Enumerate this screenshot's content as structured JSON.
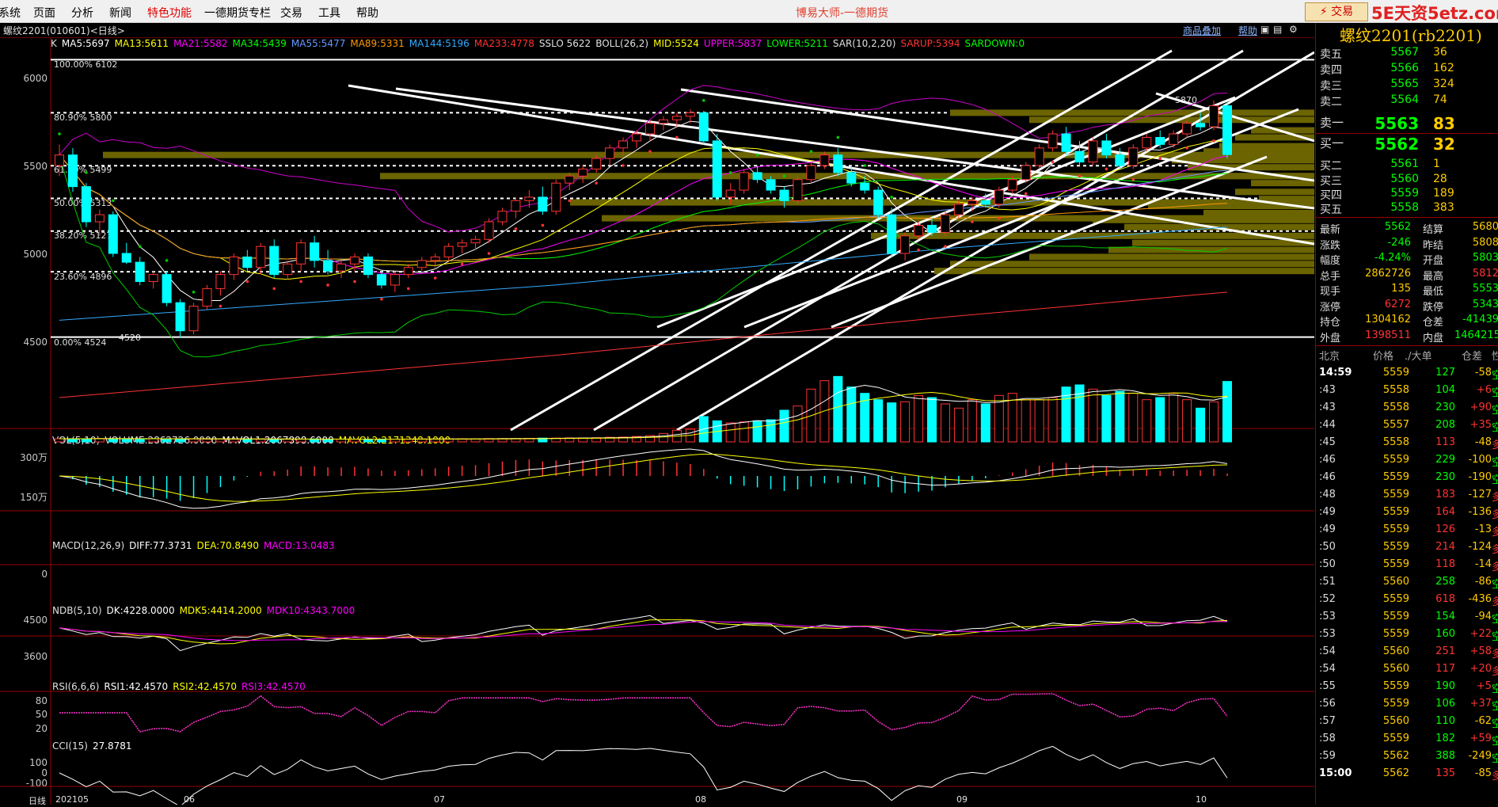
{
  "menu": {
    "items": [
      "系统",
      "页面",
      "分析",
      "新闻",
      "特色功能",
      "一德期货专栏",
      "交易",
      "工具",
      "帮助"
    ],
    "title": "博易大师-一德期货",
    "trade_button": "交易",
    "watermark": "5E天资5etz.com"
  },
  "chart_header": {
    "symbol": "螺纹2201(010601)<日线>",
    "btn_overlay": "商品叠加",
    "btn_help": "帮助"
  },
  "indicators": {
    "main": [
      {
        "text": "K",
        "color": "#e0e0e0"
      },
      {
        "text": "MA5:5697",
        "color": "#ffffff"
      },
      {
        "text": "MA13:5611",
        "color": "#ffff00"
      },
      {
        "text": "MA21:5582",
        "color": "#ff00ff"
      },
      {
        "text": "MA34:5439",
        "color": "#00ff00"
      },
      {
        "text": "MA55:5477",
        "color": "#6699ff"
      },
      {
        "text": "MA89:5331",
        "color": "#ff9900"
      },
      {
        "text": "MA144:5196",
        "color": "#33aaff"
      },
      {
        "text": "MA233:4778",
        "color": "#ff3333"
      },
      {
        "text": "SSLO 5622",
        "color": "#e0e0e0"
      },
      {
        "text": "BOLL(26,2)",
        "color": "#e0e0e0"
      },
      {
        "text": "MID:5524",
        "color": "#ffff00"
      },
      {
        "text": "UPPER:5837",
        "color": "#ff00ff"
      },
      {
        "text": "LOWER:5211",
        "color": "#00ff00"
      },
      {
        "text": "SAR(10,2,20)",
        "color": "#e0e0e0"
      },
      {
        "text": "SARUP:5394",
        "color": "#ff3333"
      },
      {
        "text": "SARDOWN:0",
        "color": "#00ff00"
      }
    ],
    "vol": [
      {
        "text": "VOL(5,10)",
        "color": "#e0e0e0"
      },
      {
        "text": "VOLUME:2862726.0000",
        "color": "#e0e0e0"
      },
      {
        "text": "MAVOL1:2067898.6000",
        "color": "#ffffff"
      },
      {
        "text": "MAVOL2:2171348.1000",
        "color": "#ffff00"
      }
    ],
    "macd": [
      {
        "text": "MACD(12,26,9)",
        "color": "#e0e0e0"
      },
      {
        "text": "DIFF:77.3731",
        "color": "#ffffff"
      },
      {
        "text": "DEA:70.8490",
        "color": "#ffff00"
      },
      {
        "text": "MACD:13.0483",
        "color": "#ff00ff"
      }
    ],
    "ndb": [
      {
        "text": "NDB(5,10)",
        "color": "#e0e0e0"
      },
      {
        "text": "DK:4228.0000",
        "color": "#ffffff"
      },
      {
        "text": "MDK5:4414.2000",
        "color": "#ffff00"
      },
      {
        "text": "MDK10:4343.7000",
        "color": "#ff00ff"
      }
    ],
    "rsi": [
      {
        "text": "RSI(6,6,6)",
        "color": "#e0e0e0"
      },
      {
        "text": "RSI1:42.4570",
        "color": "#ffffff"
      },
      {
        "text": "RSI2:42.4570",
        "color": "#ffff00"
      },
      {
        "text": "RSI3:42.4570",
        "color": "#ff00ff"
      }
    ],
    "cci": [
      {
        "text": "CCI(15)",
        "color": "#e0e0e0"
      },
      {
        "text": "27.8781",
        "color": "#ffffff"
      }
    ]
  },
  "axes": {
    "price": [
      "6000",
      "5500",
      "5000",
      "4500"
    ],
    "vol": [
      "300万",
      "150万"
    ],
    "macd": [
      "0"
    ],
    "ndb": [
      "4500",
      "3600"
    ],
    "rsi": [
      "80",
      "50",
      "20"
    ],
    "cci": [
      "100",
      "0",
      "-100"
    ],
    "xaxis_label": "日线",
    "dates": [
      "202105",
      "06",
      "07",
      "08",
      "09",
      "10"
    ]
  },
  "fib": [
    {
      "label": "100.00% 6102"
    },
    {
      "label": "80.90% 5800"
    },
    {
      "label": "61.80% 5499"
    },
    {
      "label": "50.00% 5313"
    },
    {
      "label": "38.20% 5127"
    },
    {
      "label": "23.60% 4896"
    },
    {
      "label": "0.00% 4524"
    }
  ],
  "annotations": {
    "high": "5870",
    "low": "4520"
  },
  "chart_data": {
    "type": "table",
    "candles_ohlc": [
      [
        5500,
        5620,
        5440,
        5560
      ],
      [
        5560,
        5600,
        5350,
        5380
      ],
      [
        5380,
        5400,
        5150,
        5180
      ],
      [
        5180,
        5250,
        5100,
        5220
      ],
      [
        5220,
        5240,
        4980,
        5000
      ],
      [
        5000,
        5060,
        4940,
        4950
      ],
      [
        4950,
        4980,
        4820,
        4840
      ],
      [
        4840,
        4900,
        4800,
        4880
      ],
      [
        4880,
        4900,
        4700,
        4720
      ],
      [
        4720,
        4740,
        4520,
        4560
      ],
      [
        4560,
        4720,
        4540,
        4700
      ],
      [
        4700,
        4820,
        4680,
        4800
      ],
      [
        4800,
        4900,
        4760,
        4880
      ],
      [
        4880,
        5000,
        4850,
        4980
      ],
      [
        4980,
        5020,
        4900,
        4920
      ],
      [
        4920,
        5060,
        4880,
        5040
      ],
      [
        5040,
        5080,
        4860,
        4880
      ],
      [
        4880,
        4960,
        4850,
        4940
      ],
      [
        4940,
        5080,
        4900,
        5060
      ],
      [
        5060,
        5100,
        4920,
        4960
      ],
      [
        4960,
        5020,
        4880,
        4900
      ],
      [
        4900,
        4960,
        4860,
        4940
      ],
      [
        4940,
        5000,
        4900,
        4980
      ],
      [
        4980,
        5000,
        4860,
        4880
      ],
      [
        4880,
        4900,
        4800,
        4820
      ],
      [
        4820,
        4900,
        4780,
        4880
      ],
      [
        4880,
        4940,
        4860,
        4920
      ],
      [
        4920,
        4980,
        4900,
        4960
      ],
      [
        4960,
        5000,
        4920,
        4980
      ],
      [
        4980,
        5060,
        4960,
        5040
      ],
      [
        5040,
        5080,
        5000,
        5060
      ],
      [
        5060,
        5100,
        5020,
        5080
      ],
      [
        5080,
        5200,
        5060,
        5180
      ],
      [
        5180,
        5260,
        5160,
        5240
      ],
      [
        5240,
        5320,
        5200,
        5300
      ],
      [
        5300,
        5360,
        5260,
        5320
      ],
      [
        5320,
        5380,
        5220,
        5240
      ],
      [
        5240,
        5420,
        5220,
        5400
      ],
      [
        5400,
        5460,
        5360,
        5440
      ],
      [
        5440,
        5500,
        5400,
        5480
      ],
      [
        5480,
        5560,
        5460,
        5540
      ],
      [
        5540,
        5620,
        5500,
        5600
      ],
      [
        5600,
        5660,
        5560,
        5640
      ],
      [
        5640,
        5700,
        5600,
        5680
      ],
      [
        5680,
        5760,
        5640,
        5740
      ],
      [
        5740,
        5780,
        5700,
        5760
      ],
      [
        5760,
        5800,
        5720,
        5780
      ],
      [
        5780,
        5820,
        5740,
        5800
      ],
      [
        5800,
        5810,
        5620,
        5640
      ],
      [
        5640,
        5680,
        5300,
        5320
      ],
      [
        5320,
        5400,
        5280,
        5360
      ],
      [
        5360,
        5480,
        5340,
        5460
      ],
      [
        5460,
        5500,
        5400,
        5420
      ],
      [
        5420,
        5440,
        5340,
        5360
      ],
      [
        5360,
        5380,
        5260,
        5300
      ],
      [
        5300,
        5440,
        5280,
        5420
      ],
      [
        5420,
        5520,
        5400,
        5500
      ],
      [
        5500,
        5580,
        5480,
        5560
      ],
      [
        5560,
        5600,
        5440,
        5460
      ],
      [
        5460,
        5500,
        5380,
        5400
      ],
      [
        5400,
        5440,
        5340,
        5360
      ],
      [
        5360,
        5380,
        5200,
        5220
      ],
      [
        5220,
        5260,
        4980,
        5000
      ],
      [
        5000,
        5120,
        4960,
        5100
      ],
      [
        5100,
        5180,
        5080,
        5160
      ],
      [
        5160,
        5200,
        5100,
        5120
      ],
      [
        5120,
        5240,
        5100,
        5220
      ],
      [
        5220,
        5300,
        5200,
        5280
      ],
      [
        5280,
        5320,
        5240,
        5300
      ],
      [
        5300,
        5340,
        5260,
        5280
      ],
      [
        5280,
        5380,
        5260,
        5360
      ],
      [
        5360,
        5440,
        5340,
        5420
      ],
      [
        5420,
        5520,
        5400,
        5500
      ],
      [
        5500,
        5620,
        5480,
        5600
      ],
      [
        5600,
        5700,
        5580,
        5680
      ],
      [
        5680,
        5720,
        5560,
        5580
      ],
      [
        5580,
        5640,
        5500,
        5520
      ],
      [
        5520,
        5660,
        5500,
        5640
      ],
      [
        5640,
        5680,
        5540,
        5560
      ],
      [
        5560,
        5600,
        5480,
        5500
      ],
      [
        5500,
        5620,
        5480,
        5600
      ],
      [
        5600,
        5680,
        5580,
        5660
      ],
      [
        5660,
        5700,
        5600,
        5620
      ],
      [
        5620,
        5700,
        5600,
        5680
      ],
      [
        5680,
        5760,
        5660,
        5740
      ],
      [
        5740,
        5800,
        5700,
        5720
      ],
      [
        5720,
        5870,
        5700,
        5840
      ],
      [
        5840,
        5860,
        5540,
        5562
      ]
    ],
    "volume_wan": [
      15,
      15,
      15,
      16,
      15,
      15,
      15,
      15,
      14,
      15,
      14,
      14,
      14,
      13,
      14,
      13,
      13,
      13,
      13,
      14,
      13,
      13,
      13,
      13,
      13,
      13,
      14,
      14,
      14,
      14,
      15,
      15,
      16,
      16,
      16,
      17,
      18,
      18,
      19,
      19,
      20,
      22,
      23,
      26,
      30,
      40,
      55,
      60,
      120,
      100,
      90,
      95,
      100,
      105,
      150,
      170,
      250,
      290,
      310,
      260,
      230,
      200,
      185,
      190,
      220,
      210,
      180,
      160,
      200,
      180,
      220,
      230,
      200,
      200,
      210,
      260,
      270,
      250,
      220,
      240,
      230,
      200,
      210,
      230,
      200,
      160,
      190,
      2862726
    ],
    "quote": {
      "contract": "螺纹2201(rb2201)",
      "ask": [
        [
          "卖五",
          "5567",
          "36"
        ],
        [
          "卖四",
          "5566",
          "162"
        ],
        [
          "卖三",
          "5565",
          "324"
        ],
        [
          "卖二",
          "5564",
          "74"
        ],
        [
          "卖一",
          "5563",
          "83"
        ]
      ],
      "bid": [
        [
          "买一",
          "5562",
          "32"
        ],
        [
          "买二",
          "5561",
          "1"
        ],
        [
          "买三",
          "5560",
          "28"
        ],
        [
          "买四",
          "5559",
          "189"
        ],
        [
          "买五",
          "5558",
          "383"
        ]
      ],
      "stats": [
        [
          "最新",
          "5562",
          "结算",
          "5680"
        ],
        [
          "涨跌",
          "-246",
          "昨结",
          "5808"
        ],
        [
          "幅度",
          "-4.24%",
          "开盘",
          "5803"
        ],
        [
          "总手",
          "2862726",
          "最高",
          "5812"
        ],
        [
          "现手",
          "135",
          "最低",
          "5553"
        ],
        [
          "涨停",
          "6272",
          "跌停",
          "5343"
        ],
        [
          "持仓",
          "1304162",
          "仓差",
          "-41439"
        ],
        [
          "外盘",
          "1398511",
          "内盘",
          "1464215"
        ]
      ]
    },
    "ticks_header": [
      "北京",
      "价格",
      "./大单",
      "仓差",
      "性"
    ],
    "ticks": [
      [
        "14:59",
        "5559",
        "127",
        "-58",
        "空"
      ],
      [
        ":43",
        "5558",
        "104",
        "+6",
        "空"
      ],
      [
        ":43",
        "5558",
        "230",
        "+90",
        "空"
      ],
      [
        ":44",
        "5557",
        "208",
        "+35",
        "空"
      ],
      [
        ":45",
        "5558",
        "113",
        "-48",
        "多"
      ],
      [
        ":46",
        "5559",
        "229",
        "-100",
        "空"
      ],
      [
        ":46",
        "5559",
        "230",
        "-190",
        "空"
      ],
      [
        ":48",
        "5559",
        "183",
        "-127",
        "多"
      ],
      [
        ":49",
        "5559",
        "164",
        "-136",
        "多"
      ],
      [
        ":49",
        "5559",
        "126",
        "-13",
        "多"
      ],
      [
        ":50",
        "5559",
        "214",
        "-124",
        "多"
      ],
      [
        ":50",
        "5559",
        "118",
        "-14",
        "多"
      ],
      [
        ":51",
        "5560",
        "258",
        "-86",
        "空"
      ],
      [
        ":52",
        "5559",
        "618",
        "-436",
        "多"
      ],
      [
        ":53",
        "5559",
        "154",
        "-94",
        "空"
      ],
      [
        ":53",
        "5559",
        "160",
        "+22",
        "空"
      ],
      [
        ":54",
        "5560",
        "251",
        "+58",
        "多"
      ],
      [
        ":54",
        "5560",
        "117",
        "+20",
        "多"
      ],
      [
        ":55",
        "5559",
        "190",
        "+5",
        "空"
      ],
      [
        ":56",
        "5559",
        "106",
        "+37",
        "空"
      ],
      [
        ":57",
        "5560",
        "110",
        "-62",
        "空"
      ],
      [
        ":58",
        "5559",
        "182",
        "+59",
        "空"
      ],
      [
        ":59",
        "5562",
        "388",
        "-249",
        "空"
      ],
      [
        "15:00",
        "5562",
        "135",
        "-85",
        "多"
      ]
    ]
  }
}
